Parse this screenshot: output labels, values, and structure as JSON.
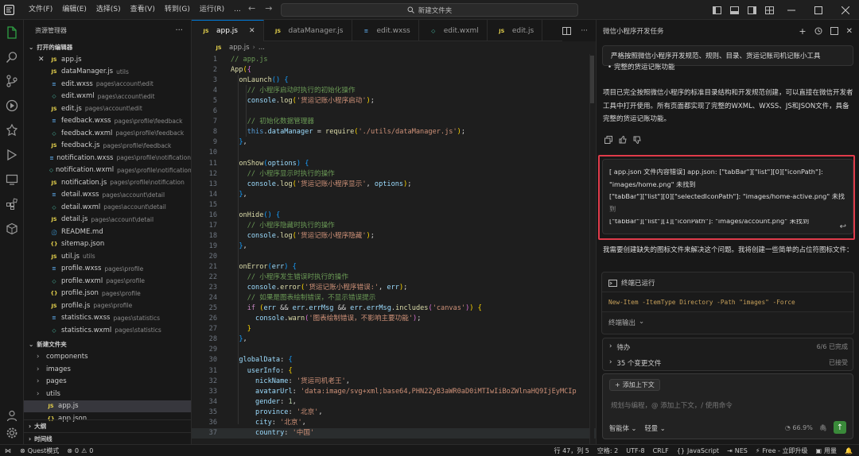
{
  "titlebar": {
    "menu": [
      "文件(F)",
      "编辑(E)",
      "选择(S)",
      "查看(V)",
      "转到(G)",
      "运行(R)",
      "..."
    ],
    "search": "新建文件夹"
  },
  "explorer": {
    "title": "资源管理器",
    "open_editors_label": "打开的编辑器",
    "open_editors": [
      {
        "badge": "JS",
        "type": "js",
        "name": "app.js",
        "path": "",
        "closable": true
      },
      {
        "badge": "JS",
        "type": "js",
        "name": "dataManager.js",
        "path": "utils"
      },
      {
        "badge": "≡",
        "type": "wxss",
        "name": "edit.wxss",
        "path": "pages\\account\\edit"
      },
      {
        "badge": "◇",
        "type": "wxml",
        "name": "edit.wxml",
        "path": "pages\\account\\edit"
      },
      {
        "badge": "JS",
        "type": "js",
        "name": "edit.js",
        "path": "pages\\account\\edit"
      },
      {
        "badge": "≡",
        "type": "wxss",
        "name": "feedback.wxss",
        "path": "pages\\profile\\feedback"
      },
      {
        "badge": "◇",
        "type": "wxml",
        "name": "feedback.wxml",
        "path": "pages\\profile\\feedback"
      },
      {
        "badge": "JS",
        "type": "js",
        "name": "feedback.js",
        "path": "pages\\profile\\feedback"
      },
      {
        "badge": "≡",
        "type": "wxss",
        "name": "notification.wxss",
        "path": "pages\\profile\\notification"
      },
      {
        "badge": "◇",
        "type": "wxml",
        "name": "notification.wxml",
        "path": "pages\\profile\\notification"
      },
      {
        "badge": "JS",
        "type": "js",
        "name": "notification.js",
        "path": "pages\\profile\\notification"
      },
      {
        "badge": "≡",
        "type": "wxss",
        "name": "detail.wxss",
        "path": "pages\\account\\detail"
      },
      {
        "badge": "◇",
        "type": "wxml",
        "name": "detail.wxml",
        "path": "pages\\account\\detail"
      },
      {
        "badge": "JS",
        "type": "js",
        "name": "detail.js",
        "path": "pages\\account\\detail"
      },
      {
        "badge": "ⓘ",
        "type": "md",
        "name": "README.md",
        "path": ""
      },
      {
        "badge": "{}",
        "type": "json",
        "name": "sitemap.json",
        "path": ""
      },
      {
        "badge": "JS",
        "type": "js",
        "name": "util.js",
        "path": "utils"
      },
      {
        "badge": "≡",
        "type": "wxss",
        "name": "profile.wxss",
        "path": "pages\\profile"
      },
      {
        "badge": "◇",
        "type": "wxml",
        "name": "profile.wxml",
        "path": "pages\\profile"
      },
      {
        "badge": "{}",
        "type": "json",
        "name": "profile.json",
        "path": "pages\\profile"
      },
      {
        "badge": "JS",
        "type": "js",
        "name": "profile.js",
        "path": "pages\\profile"
      },
      {
        "badge": "≡",
        "type": "wxss",
        "name": "statistics.wxss",
        "path": "pages\\statistics"
      },
      {
        "badge": "◇",
        "type": "wxml",
        "name": "statistics.wxml",
        "path": "pages\\statistics"
      }
    ],
    "folder_label": "新建文件夹",
    "folder_items": [
      {
        "kind": "folder",
        "name": "components"
      },
      {
        "kind": "folder",
        "name": "images"
      },
      {
        "kind": "folder",
        "name": "pages"
      },
      {
        "kind": "folder",
        "name": "utils"
      },
      {
        "kind": "file",
        "badge": "JS",
        "type": "js",
        "name": "app.js",
        "selected": true
      },
      {
        "kind": "file",
        "badge": "{}",
        "type": "json",
        "name": "app.json"
      }
    ],
    "outline_label": "大纲",
    "timeline_label": "时间线"
  },
  "tabs": [
    {
      "badge": "JS",
      "type": "js",
      "label": "app.js",
      "active": true
    },
    {
      "badge": "JS",
      "type": "js",
      "label": "dataManager.js"
    },
    {
      "badge": "≡",
      "type": "wxss",
      "label": "edit.wxss"
    },
    {
      "badge": "◇",
      "type": "wxml",
      "label": "edit.wxml"
    },
    {
      "badge": "JS",
      "type": "js",
      "label": "edit.js"
    }
  ],
  "breadcrumb": {
    "file": "app.js",
    "rest": "..."
  },
  "code": [
    {
      "n": "1",
      "html": "<span class='cm'>// app.js</span>"
    },
    {
      "n": "2",
      "html": "<span class='fn'>App</span><span class='br1'>(</span><span class='br2'>{</span>"
    },
    {
      "n": "3",
      "html": "  <span class='fn'>onLaunch</span><span class='br3'>()</span> <span class='br3'>{</span>"
    },
    {
      "n": "4",
      "html": "    <span class='cm'>// 小程序启动时执行的初始化操作</span>"
    },
    {
      "n": "5",
      "html": "    <span class='prop'>console</span>.<span class='fn'>log</span><span class='br1'>(</span><span class='str'>'货运记账小程序启动'</span><span class='br1'>)</span>;"
    },
    {
      "n": "6",
      "html": ""
    },
    {
      "n": "7",
      "html": "    <span class='cm'>// 初始化数据管理器</span>"
    },
    {
      "n": "8",
      "html": "    <span class='blue'>this</span>.<span class='prop'>dataManager</span> = <span class='fn'>require</span><span class='br1'>(</span><span class='str'>'./utils/dataManager.js'</span><span class='br1'>)</span>;"
    },
    {
      "n": "9",
      "html": "  <span class='br3'>}</span>,"
    },
    {
      "n": "10",
      "html": ""
    },
    {
      "n": "11",
      "html": "  <span class='fn'>onShow</span><span class='br3'>(</span><span class='prop'>options</span><span class='br3'>)</span> <span class='br3'>{</span>"
    },
    {
      "n": "12",
      "html": "    <span class='cm'>// 小程序显示时执行的操作</span>"
    },
    {
      "n": "13",
      "html": "    <span class='prop'>console</span>.<span class='fn'>log</span><span class='br1'>(</span><span class='str'>'货运记账小程序显示'</span>, <span class='prop'>options</span><span class='br1'>)</span>;"
    },
    {
      "n": "14",
      "html": "  <span class='br3'>}</span>,"
    },
    {
      "n": "15",
      "html": ""
    },
    {
      "n": "16",
      "html": "  <span class='fn'>onHide</span><span class='br3'>()</span> <span class='br3'>{</span>"
    },
    {
      "n": "17",
      "html": "    <span class='cm'>// 小程序隐藏时执行的操作</span>"
    },
    {
      "n": "18",
      "html": "    <span class='prop'>console</span>.<span class='fn'>log</span><span class='br1'>(</span><span class='str'>'货运记账小程序隐藏'</span><span class='br1'>)</span>;"
    },
    {
      "n": "19",
      "html": "  <span class='br3'>}</span>,"
    },
    {
      "n": "20",
      "html": ""
    },
    {
      "n": "21",
      "html": "  <span class='fn'>onError</span><span class='br3'>(</span><span class='prop'>err</span><span class='br3'>)</span> <span class='br3'>{</span>"
    },
    {
      "n": "22",
      "html": "    <span class='cm'>// 小程序发生错误时执行的操作</span>"
    },
    {
      "n": "23",
      "html": "    <span class='prop'>console</span>.<span class='fn'>error</span><span class='br1'>(</span><span class='str'>'货运记账小程序错误:'</span>, <span class='prop'>err</span><span class='br1'>)</span>;"
    },
    {
      "n": "24",
      "html": "    <span class='cm'>// 如果是图表绘制错误，不显示错误提示</span>"
    },
    {
      "n": "25",
      "html": "    <span class='kw'>if</span> <span class='br1'>(</span><span class='prop'>err</span> &amp;&amp; <span class='prop'>err</span>.<span class='prop'>errMsg</span> &amp;&amp; <span class='prop'>err</span>.<span class='prop'>errMsg</span>.<span class='fn'>includes</span><span class='br2'>(</span><span class='str'>'canvas'</span><span class='br2'>)</span><span class='br1'>)</span> <span class='br1'>{</span>"
    },
    {
      "n": "26",
      "html": "      <span class='prop'>console</span>.<span class='fn'>warn</span><span class='br2'>(</span><span class='str'>'图表绘制错误，不影响主要功能'</span><span class='br2'>)</span>;"
    },
    {
      "n": "27",
      "html": "    <span class='br1'>}</span>"
    },
    {
      "n": "28",
      "html": "  <span class='br3'>}</span>,"
    },
    {
      "n": "29",
      "html": ""
    },
    {
      "n": "30",
      "html": "  <span class='prop'>globalData</span>: <span class='br3'>{</span>"
    },
    {
      "n": "31",
      "html": "    <span class='prop'>userInfo</span>: <span class='br1'>{</span>"
    },
    {
      "n": "32",
      "html": "      <span class='prop'>nickName</span>: <span class='str'>'货运司机老王'</span>,"
    },
    {
      "n": "33",
      "html": "      <span class='prop'>avatarUrl</span>: <span class='str'>'data:image/svg+xml;base64,PHN2ZyB3aWR0aD0iMTIwIiBoZWlnaHQ9IjEyMCIp</span>"
    },
    {
      "n": "34",
      "html": "      <span class='prop'>gender</span>: <span class='num'>1</span>,"
    },
    {
      "n": "35",
      "html": "      <span class='prop'>province</span>: <span class='str'>'北京'</span>,"
    },
    {
      "n": "36",
      "html": "      <span class='prop'>city</span>: <span class='str'>'北京'</span>,"
    },
    {
      "n": "37",
      "html": "      <span class='prop'>country</span>: <span class='str'>'中国'</span>"
    }
  ],
  "panel": {
    "title": "微信小程序开发任务",
    "task_box": "严格按照微信小程序开发规范、规则、目录、货运记账司机记账小工具",
    "bullet": "完整的货运记账功能",
    "para1": "项目已完全按照微信小程序的标准目录结构和开发规范创建，可以直接在微信开发者工具中打开使用。所有页面都实现了完整的WXML、WXSS、JS和JSON文件，具备完整的货运记账功能。",
    "error_lines": [
      "[ app.json 文件内容错误] app.json: [\"tabBar\"][\"list\"][0][\"iconPath\"]: \"images/home.png\" 未找到",
      "[\"tabBar\"][\"list\"][0][\"selectedIconPath\"]: \"images/home-active.png\" 未找到",
      "[\"tabBar\"][\"list\"][1][\"iconPath\"]: \"images/account.png\" 未找到"
    ],
    "para2": "我需要创建缺失的图标文件来解决这个问题。我将创建一些简单的占位符图标文件：",
    "terminal_label": "终端已运行",
    "terminal_cmd": "New-Item -ItemType Directory -Path \"images\" -Force",
    "terminal_output": "终端输出",
    "partial_text": "...",
    "todo_label": "待办",
    "todo_status": "6/6 已完成",
    "changes_label": "35 个变更文件",
    "changes_action": "已接受",
    "add_context": "添加上下文",
    "input_placeholder": "规划与编程，@ 添加上下文，/ 使用命令",
    "agent_label": "智能体",
    "model_label": "轻量",
    "usage": "66.9%"
  },
  "statusbar": {
    "mode": "Quest模式",
    "errors": "0",
    "warnings": "0",
    "cursor": "行 47，列 5",
    "spaces": "空格: 2",
    "encoding": "UTF-8",
    "eol": "CRLF",
    "language": "JavaScript",
    "nes": "NES",
    "plan": "Free - 立即升级",
    "app": "用量"
  }
}
